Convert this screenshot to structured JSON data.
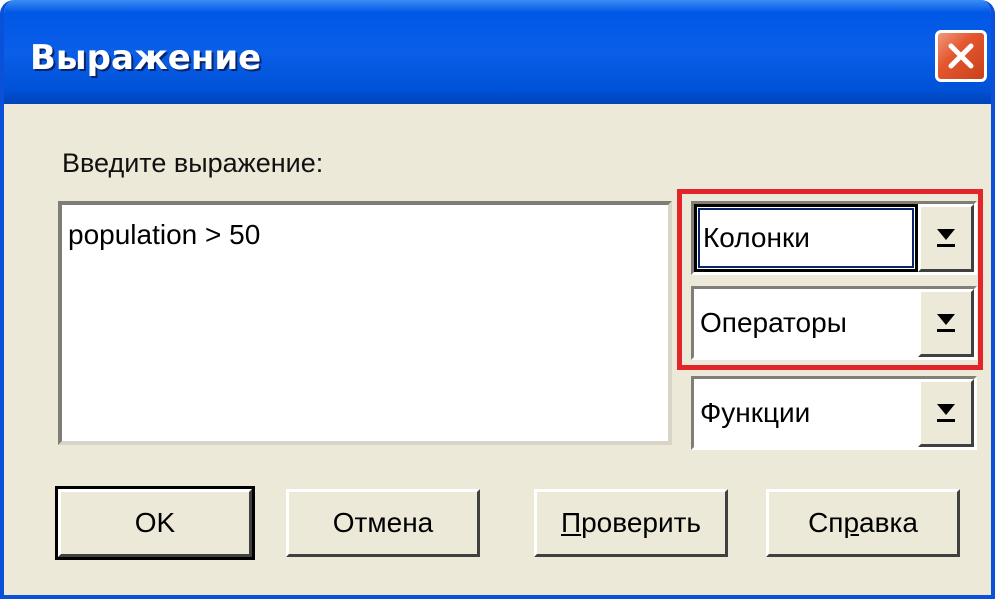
{
  "window": {
    "title": "Выражение",
    "close_icon": "close-icon"
  },
  "expression": {
    "label": "Введите выражение:",
    "value": "population > 50"
  },
  "dropdowns": {
    "columns": {
      "value": "Колонки"
    },
    "operators": {
      "value": "Операторы"
    },
    "functions": {
      "value": "Функции"
    }
  },
  "buttons": {
    "ok": "OK",
    "cancel": "Отмена",
    "verify": {
      "first": "П",
      "rest": "роверить"
    },
    "help": {
      "pre": "Сп",
      "u": "р",
      "post": "авка"
    }
  },
  "colors": {
    "titlebar": "#0058e6",
    "dialog_bg": "#ece9d8",
    "close_button": "#e4572f",
    "highlight": "#e3242b"
  }
}
